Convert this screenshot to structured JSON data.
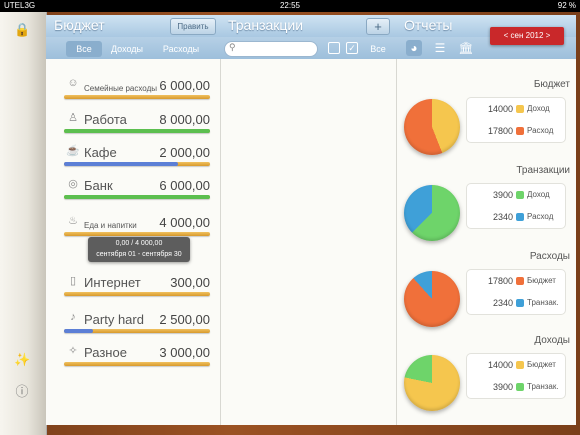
{
  "status": {
    "carrier": "UTEL3G",
    "time": "22:55",
    "battery": "92 %"
  },
  "budget": {
    "title": "Бюджет",
    "edit": "Править",
    "tabs": [
      "Все",
      "Доходы",
      "Расходы"
    ],
    "items": [
      {
        "icon": "family-icon",
        "name": "Семейные расходы",
        "amount": "6 000,00",
        "fill": 0,
        "color": "#f0c160"
      },
      {
        "icon": "person-icon",
        "name": "Работа",
        "amount": "8 000,00",
        "fill": 1.0,
        "color": "#5cbf4f"
      },
      {
        "icon": "cup-icon",
        "name": "Кафе",
        "amount": "2 000,00",
        "fill": 0.78,
        "color": "#5c7fd6"
      },
      {
        "icon": "coins-icon",
        "name": "Банк",
        "amount": "6 000,00",
        "fill": 1.0,
        "color": "#5cbf4f"
      },
      {
        "icon": "cake-icon",
        "name": "Еда и напитки",
        "amount": "4 000,00",
        "fill": 0,
        "color": "#f0c160"
      },
      {
        "icon": "phone-icon",
        "name": "Интернет",
        "amount": "300,00",
        "fill": 0,
        "color": "#f0c160"
      },
      {
        "icon": "party-icon",
        "name": "Party hard",
        "amount": "2 500,00",
        "fill": 0.2,
        "color": "#5c7fd6"
      },
      {
        "icon": "wand-icon",
        "name": "Разное",
        "amount": "3 000,00",
        "fill": 0,
        "color": "#f0c160"
      }
    ],
    "tooltip": {
      "line1": "0,00 / 4 000,00",
      "line2": "сентября 01 - сентября 30"
    }
  },
  "transactions": {
    "title": "Транзакции",
    "add": "+",
    "filter_all": "Все",
    "search_placeholder": ""
  },
  "reports": {
    "title": "Отчеты",
    "period": "< сен 2012 >",
    "sections": [
      {
        "title": "Бюджет",
        "pie": [
          {
            "value": 14000,
            "color": "#f5c64e"
          },
          {
            "value": 17800,
            "color": "#f0703a"
          }
        ],
        "legend": [
          {
            "value": "14000",
            "label": "Доход",
            "color": "#f5c64e"
          },
          {
            "value": "17800",
            "label": "Расход",
            "color": "#f0703a"
          }
        ]
      },
      {
        "title": "Транзакции",
        "pie": [
          {
            "value": 3900,
            "color": "#6ed46a"
          },
          {
            "value": 2340,
            "color": "#3fa0d8"
          }
        ],
        "legend": [
          {
            "value": "3900",
            "label": "Доход",
            "color": "#6ed46a"
          },
          {
            "value": "2340",
            "label": "Расход",
            "color": "#3fa0d8"
          }
        ]
      },
      {
        "title": "Расходы",
        "pie": [
          {
            "value": 17800,
            "color": "#f0703a"
          },
          {
            "value": 2340,
            "color": "#3fa0d8"
          }
        ],
        "legend": [
          {
            "value": "17800",
            "label": "Бюджет",
            "color": "#f0703a"
          },
          {
            "value": "2340",
            "label": "Транзак.",
            "color": "#3fa0d8"
          }
        ]
      },
      {
        "title": "Доходы",
        "pie": [
          {
            "value": 14000,
            "color": "#f5c64e"
          },
          {
            "value": 3900,
            "color": "#6ed46a"
          }
        ],
        "legend": [
          {
            "value": "14000",
            "label": "Бюджет",
            "color": "#f5c64e"
          },
          {
            "value": "3900",
            "label": "Транзак.",
            "color": "#6ed46a"
          }
        ]
      }
    ]
  }
}
